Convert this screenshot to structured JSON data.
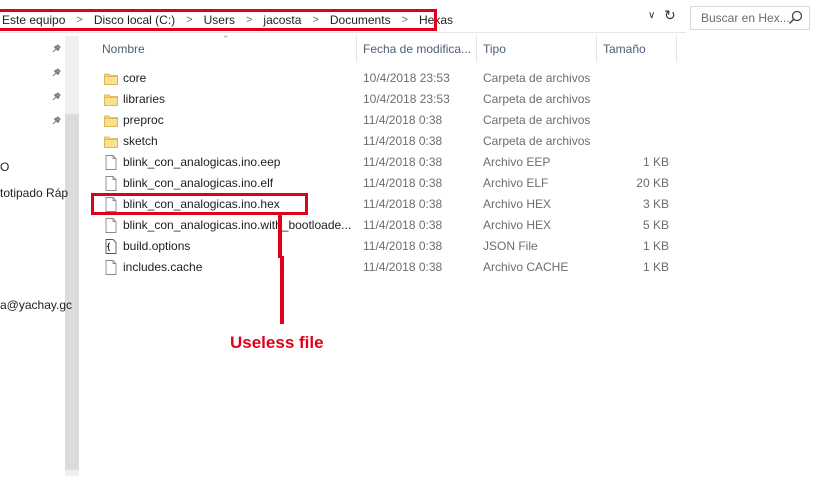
{
  "breadcrumbs": [
    "Este equipo",
    "Disco local (C:)",
    "Users",
    "jacosta",
    "Documents",
    "Hexas"
  ],
  "breadcrumb_separator": ">",
  "search": {
    "placeholder": "Buscar en Hex..."
  },
  "nav": {
    "partial_items": [
      "O",
      "totipado Ráp",
      "a@yachay.gc"
    ]
  },
  "columns": {
    "name": "Nombre",
    "date": "Fecha de modifica...",
    "type": "Tipo",
    "size": "Tamaño"
  },
  "files": [
    {
      "name": "core",
      "date": "10/4/2018 23:53",
      "type": "Carpeta de archivos",
      "size": "",
      "icon": "folder-icon"
    },
    {
      "name": "libraries",
      "date": "10/4/2018 23:53",
      "type": "Carpeta de archivos",
      "size": "",
      "icon": "folder-icon"
    },
    {
      "name": "preproc",
      "date": "11/4/2018 0:38",
      "type": "Carpeta de archivos",
      "size": "",
      "icon": "folder-icon"
    },
    {
      "name": "sketch",
      "date": "11/4/2018 0:38",
      "type": "Carpeta de archivos",
      "size": "",
      "icon": "folder-icon"
    },
    {
      "name": "blink_con_analogicas.ino.eep",
      "date": "11/4/2018 0:38",
      "type": "Archivo EEP",
      "size": "1 KB",
      "icon": "file-icon"
    },
    {
      "name": "blink_con_analogicas.ino.elf",
      "date": "11/4/2018 0:38",
      "type": "Archivo ELF",
      "size": "20 KB",
      "icon": "file-icon"
    },
    {
      "name": "blink_con_analogicas.ino.hex",
      "date": "11/4/2018 0:38",
      "type": "Archivo HEX",
      "size": "3 KB",
      "icon": "file-icon"
    },
    {
      "name": "blink_con_analogicas.ino.with_bootloade...",
      "date": "11/4/2018 0:38",
      "type": "Archivo HEX",
      "size": "5 KB",
      "icon": "file-icon"
    },
    {
      "name": "build.options",
      "date": "11/4/2018 0:38",
      "type": "JSON File",
      "size": "1 KB",
      "icon": "json-file-icon"
    },
    {
      "name": "includes.cache",
      "date": "11/4/2018 0:38",
      "type": "Archivo CACHE",
      "size": "1 KB",
      "icon": "file-icon"
    }
  ],
  "annotation": {
    "text": "Useless file",
    "color": "#e0001b"
  }
}
